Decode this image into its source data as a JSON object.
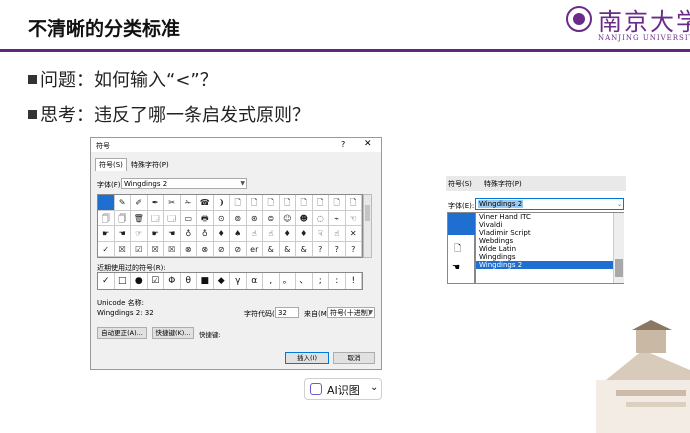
{
  "slide": {
    "title": "不清晰的分类标准",
    "bullet1": "问题：如何输入“<”？",
    "bullet2": "思考：违反了哪一条启发式原则？"
  },
  "logo": {
    "cn": "南京大学",
    "en": "NANJING UNIVERSITY"
  },
  "dialog": {
    "title": "符号",
    "help": "?",
    "close": "✕",
    "tab_symbols": "符号(S)",
    "tab_special": "特殊字符(P)",
    "font_label": "字体(F):",
    "font_value": "Wingdings 2",
    "grid": [
      "",
      "✎",
      "✐",
      "✒",
      "✂",
      "✁",
      "☎",
      "❩",
      "🗋",
      "🗋",
      "🗋",
      "🗋",
      "🗋",
      "🗋",
      "🗋",
      "🗋",
      "🗍",
      "🗍",
      "🗑",
      "🗔",
      "🗔",
      "▭",
      "🖶",
      "⊙",
      "⊚",
      "⊛",
      "⊜",
      "☺",
      "☻",
      "◌",
      "⌁",
      "☜",
      "☛",
      "☚",
      "☞",
      "☛",
      "☚",
      "♁",
      "♁",
      "♦",
      "♠",
      "☝",
      "☝",
      "♦",
      "♦",
      "☟",
      "☝",
      "✕",
      "✓",
      "☒",
      "☑",
      "☒",
      "☒",
      "⊗",
      "⊗",
      "⊘",
      "⊘",
      "er",
      "&",
      "&",
      "&",
      "?",
      "?",
      "?"
    ],
    "recent_label": "近期使用过的符号(R):",
    "recent": [
      "✓",
      "□",
      "●",
      "☑",
      "Φ",
      "θ",
      "■",
      "◆",
      "γ",
      "α",
      ",",
      "。",
      "、",
      ";",
      ":",
      "!"
    ],
    "unicode_label": "Unicode 名称:",
    "unicode_value": "Wingdings 2: 32",
    "code_label": "字符代码(C):",
    "code_value": "32",
    "from_label": "来自(M):",
    "from_value": "符号(十进制)",
    "autocorrect": "自动更正(A)...",
    "shortcut_btn": "快捷键(K)...",
    "shortcut_label": "快捷键:",
    "insert": "插入(I)",
    "cancel": "取消"
  },
  "panel": {
    "tab_symbols": "符号(S)",
    "tab_special": "特殊字符(P)",
    "font_label": "字体(E):",
    "font_value": "Wingdings 2",
    "options": [
      "Viner Hand ITC",
      "Vivaldi",
      "Vladimir Script",
      "Webdings",
      "Wide Latin",
      "Wingdings",
      "Wingdings 2"
    ]
  },
  "ai_button": {
    "label": "AI识图",
    "chevron": "⌄"
  }
}
